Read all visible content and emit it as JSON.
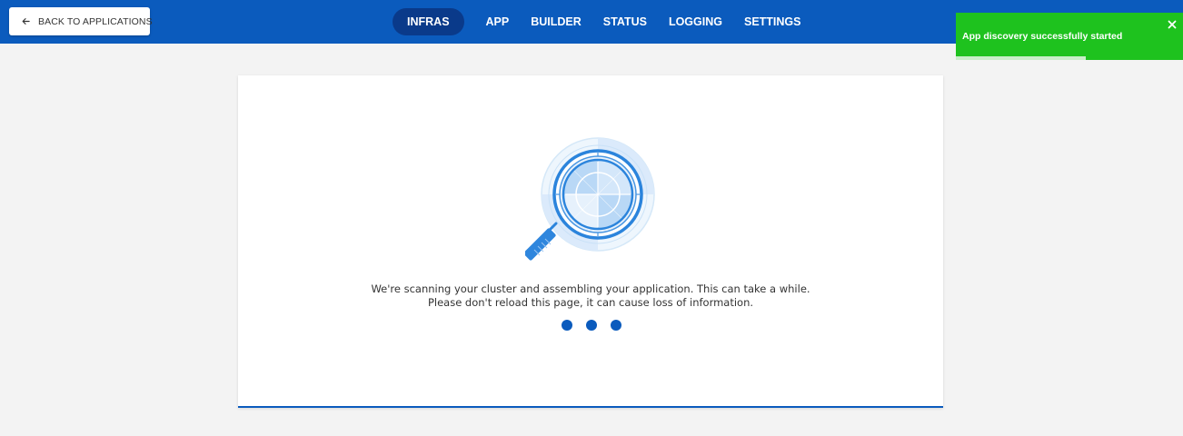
{
  "header": {
    "back_label": "BACK TO APPLICATIONS",
    "nav": [
      {
        "label": "INFRAS",
        "active": true
      },
      {
        "label": "APP",
        "active": false
      },
      {
        "label": "BUILDER",
        "active": false
      },
      {
        "label": "STATUS",
        "active": false
      },
      {
        "label": "LOGGING",
        "active": false
      },
      {
        "label": "SETTINGS",
        "active": false
      }
    ]
  },
  "toast": {
    "message": "App discovery successfully started",
    "progress": 0.57,
    "icon": "close-icon"
  },
  "main": {
    "illustration": "magnifier-radar-icon",
    "message_line1": "We're scanning your cluster and assembling your application. This can take a while.",
    "message_line2": "Please don't reload this page, it can cause loss of information.",
    "loading_dots": 3
  },
  "colors": {
    "brand": "#0b5bbd",
    "active_nav": "#0a3a8a",
    "toast": "#1ec21e",
    "background": "#f3f3f3"
  }
}
